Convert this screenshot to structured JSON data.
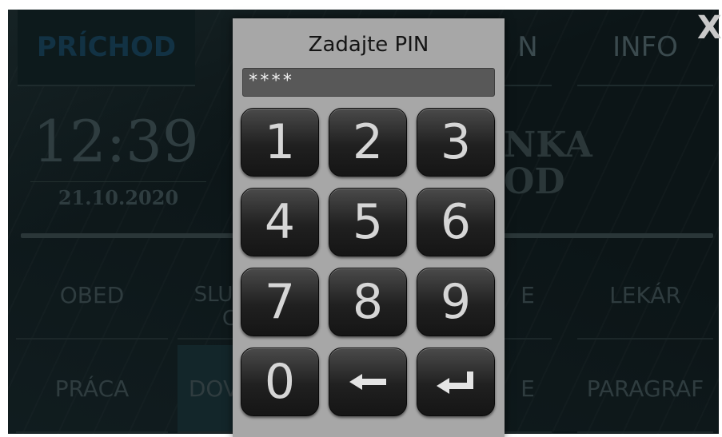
{
  "background": {
    "top_buttons": {
      "prichod": "PRÍCHOD",
      "hidden_letter": "N",
      "info": "INFO"
    },
    "clock": {
      "time": "12:39",
      "date": "21.10.2020"
    },
    "headline": {
      "line1": "NKA",
      "line2": "OD"
    },
    "grid": {
      "row1": {
        "obed": "OBED",
        "sluzba_partial_1": "SLU",
        "sluzba_partial_2": "C",
        "mid": "E",
        "lekar": "LEKÁR"
      },
      "row2": {
        "praca": "PRÁCA",
        "dov": "DOV",
        "mid": "E",
        "paragraf": "PARAGRAF"
      }
    },
    "close_label": "X"
  },
  "dialog": {
    "title": "Zadajte PIN",
    "pin_value": "****",
    "keys": [
      "1",
      "2",
      "3",
      "4",
      "5",
      "6",
      "7",
      "8",
      "9",
      "0"
    ],
    "backspace_icon": "arrow-left-icon",
    "enter_icon": "enter-return-icon"
  },
  "colors": {
    "dialog_bg": "#a7a7a7",
    "key_bg": "#1c1c1c",
    "key_text": "#d6d6d6",
    "screen_bg": "#0c1517"
  }
}
